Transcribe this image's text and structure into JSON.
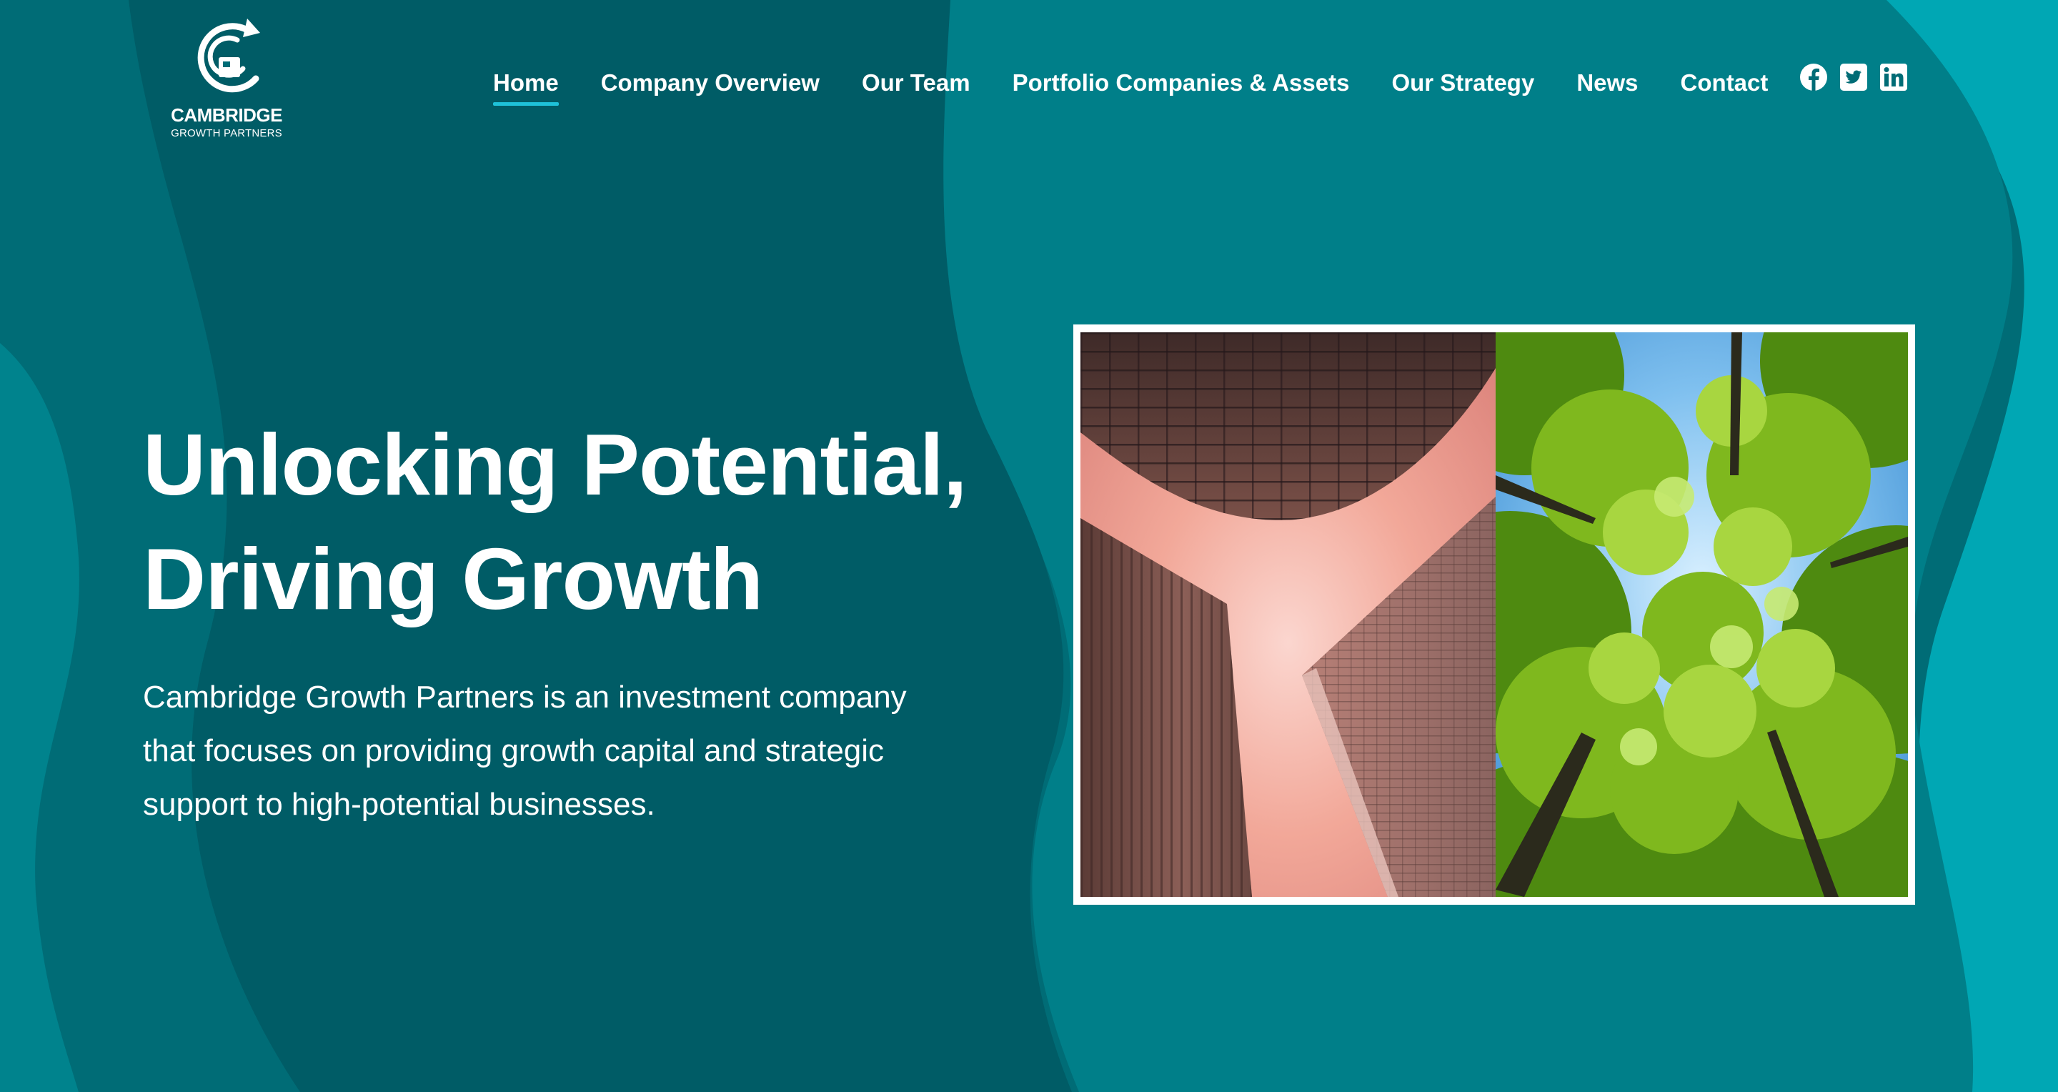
{
  "brand": {
    "name": "CAMBRIDGE",
    "tagline": "GROWTH PARTNERS"
  },
  "nav": {
    "items": [
      {
        "label": "Home",
        "active": true
      },
      {
        "label": "Company Overview",
        "active": false
      },
      {
        "label": "Our Team",
        "active": false
      },
      {
        "label": "Portfolio Companies & Assets",
        "active": false
      },
      {
        "label": "Our Strategy",
        "active": false
      },
      {
        "label": "News",
        "active": false
      },
      {
        "label": "Contact",
        "active": false
      }
    ]
  },
  "social": {
    "icons": [
      "facebook-icon",
      "twitter-icon",
      "linkedin-icon"
    ]
  },
  "hero": {
    "title_line1": "Unlocking Potential,",
    "title_line2": "Driving Growth",
    "description_line1": "Cambridge Growth Partners is an investment company",
    "description_line2": "that focuses on providing growth capital and strategic",
    "description_line3": "support to high-potential businesses."
  },
  "colors": {
    "background_dark": "#005b65",
    "background_mid": "#007f89",
    "background_light": "#00a5b2",
    "nav_active_underline": "#1ec2d9",
    "text": "#ffffff"
  }
}
